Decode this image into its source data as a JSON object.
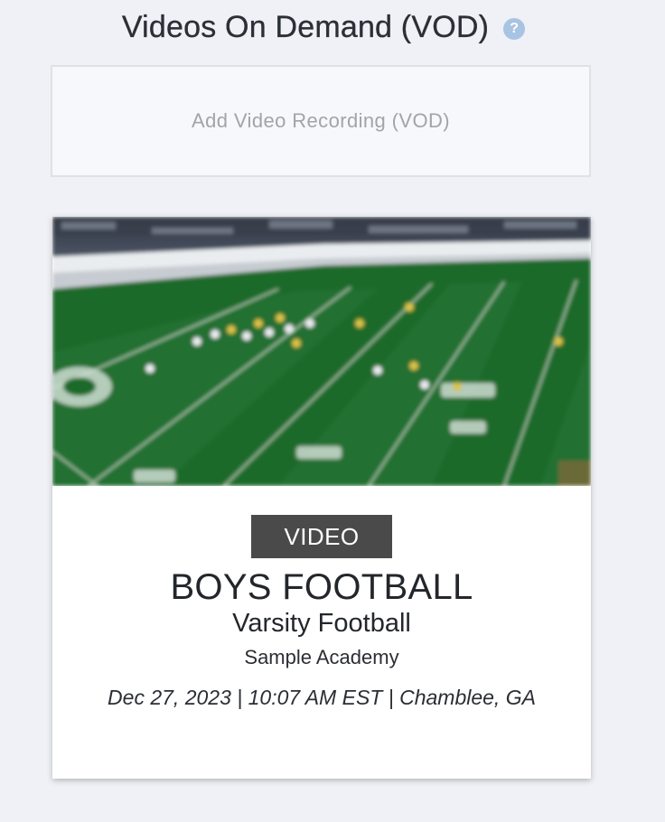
{
  "header": {
    "title": "Videos On Demand (VOD)",
    "help_icon": "question-circle-icon",
    "help_glyph": "?"
  },
  "add_vod": {
    "label": "Add Video Recording (VOD)"
  },
  "video_card": {
    "thumbnail": "football-field-image",
    "badge": "VIDEO",
    "sport": "BOYS FOOTBALL",
    "level": "Varsity Football",
    "school": "Sample Academy",
    "meta": "Dec 27, 2023 | 10:07 AM EST | Chamblee, GA"
  },
  "colors": {
    "background": "#eff1f6",
    "help_icon": "#a9c4e2",
    "badge_bg": "#4a4a4a",
    "field_green": "#1f6a2c"
  }
}
